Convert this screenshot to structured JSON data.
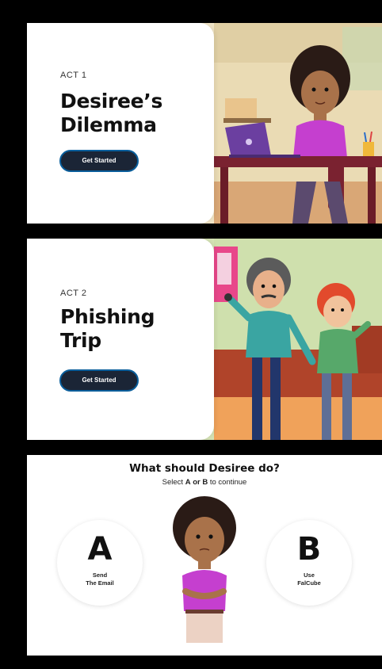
{
  "acts": [
    {
      "label": "ACT 1",
      "title_line1": "Desiree’s",
      "title_line2": "Dilemma",
      "button": "Get Started"
    },
    {
      "label": "ACT 2",
      "title_line1": "Phishing",
      "title_line2": "Trip",
      "button": "Get Started"
    }
  ],
  "choice": {
    "question": "What should Desiree do?",
    "sub_prefix": "Select",
    "sub_a": "A",
    "sub_or": "or",
    "sub_b": "B",
    "sub_suffix": "to continue",
    "options": [
      {
        "letter": "A",
        "line1": "Send",
        "line2": "The Email"
      },
      {
        "letter": "B",
        "line1": "Use",
        "line2": "FalCube"
      }
    ]
  },
  "colors": {
    "button_bg": "#1b2536",
    "button_border": "#0a5e9b",
    "shirt": "#c53fcf",
    "skin": "#a9724a"
  }
}
